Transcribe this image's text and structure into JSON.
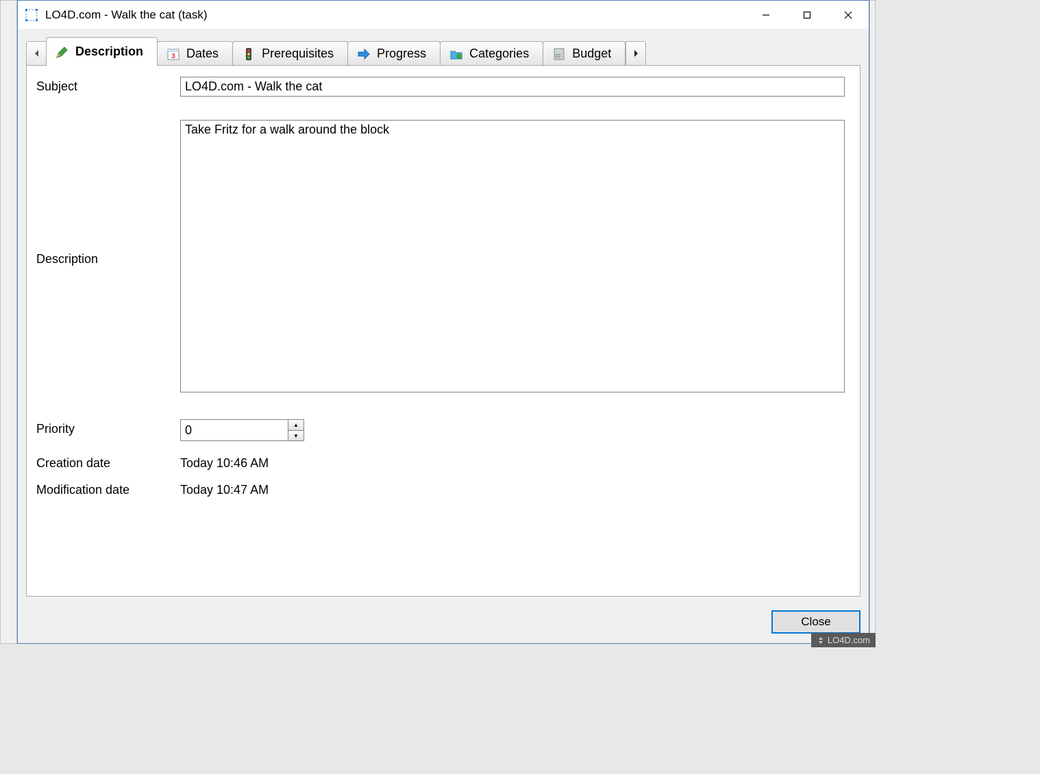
{
  "window": {
    "title": "LO4D.com - Walk the cat (task)"
  },
  "tabs": {
    "description": "Description",
    "dates": "Dates",
    "prerequisites": "Prerequisites",
    "progress": "Progress",
    "categories": "Categories",
    "budget": "Budget"
  },
  "labels": {
    "subject": "Subject",
    "description": "Description",
    "priority": "Priority",
    "creation_date": "Creation date",
    "modification_date": "Modification date"
  },
  "fields": {
    "subject": "LO4D.com - Walk the cat",
    "description": "Take Fritz for a walk around the block",
    "priority": "0",
    "creation_date": "Today 10:46 AM",
    "modification_date": "Today 10:47 AM"
  },
  "buttons": {
    "close": "Close"
  },
  "watermark": "LO4D.com"
}
